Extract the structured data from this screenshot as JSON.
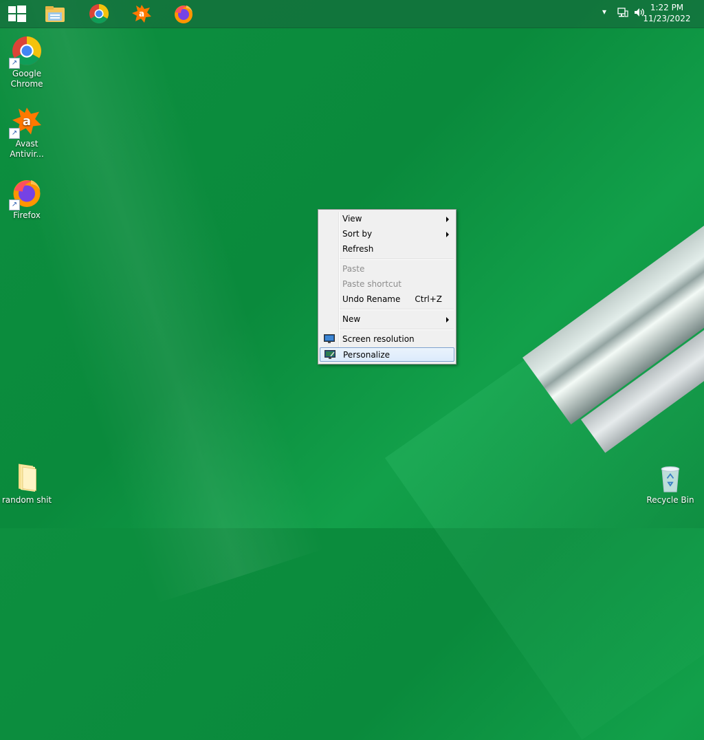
{
  "taskbar": {
    "pinned": [
      {
        "name": "start-button",
        "icon": "windows-logo-icon"
      },
      {
        "name": "file-explorer",
        "icon": "folder-icon"
      },
      {
        "name": "google-chrome",
        "icon": "chrome-icon"
      },
      {
        "name": "avast",
        "icon": "avast-icon"
      },
      {
        "name": "firefox",
        "icon": "firefox-icon"
      }
    ],
    "tray": {
      "show_hidden": "▾",
      "network_icon": "network-icon",
      "volume_icon": "volume-icon"
    },
    "clock": {
      "time": "1:22 PM",
      "date": "11/23/2022"
    }
  },
  "desktop": {
    "icons": [
      {
        "label": "Google\nChrome",
        "line1": "Google",
        "line2": "Chrome",
        "icon": "chrome-icon"
      },
      {
        "label": "Avast Antivir...",
        "line1": "Avast",
        "line2": "Antivir...",
        "icon": "avast-icon"
      },
      {
        "label": "Firefox",
        "line1": "Firefox",
        "line2": "",
        "icon": "firefox-icon"
      },
      {
        "label": "random shit",
        "line1": "random shit",
        "line2": "",
        "icon": "folder-icon"
      },
      {
        "label": "Recycle Bin",
        "line1": "Recycle Bin",
        "line2": "",
        "icon": "recycle-bin-icon"
      }
    ]
  },
  "context_menu": {
    "items": [
      {
        "label": "View",
        "submenu": true,
        "disabled": false
      },
      {
        "label": "Sort by",
        "submenu": true,
        "disabled": false
      },
      {
        "label": "Refresh",
        "submenu": false,
        "disabled": false
      },
      {
        "label": "Paste",
        "submenu": false,
        "disabled": true
      },
      {
        "label": "Paste shortcut",
        "submenu": false,
        "disabled": true
      },
      {
        "label": "Undo Rename",
        "shortcut": "Ctrl+Z",
        "submenu": false,
        "disabled": false
      },
      {
        "label": "New",
        "submenu": true,
        "disabled": false
      },
      {
        "label": "Screen resolution",
        "icon": "monitor-icon",
        "submenu": false,
        "disabled": false
      },
      {
        "label": "Personalize",
        "icon": "personalize-icon",
        "submenu": false,
        "disabled": false,
        "highlighted": true
      }
    ]
  },
  "colors": {
    "wallpaper": "#0d8f3f",
    "taskbar": "#146e3c",
    "menu_bg": "#f0f0f0",
    "menu_highlight_border": "#7da2ce"
  }
}
